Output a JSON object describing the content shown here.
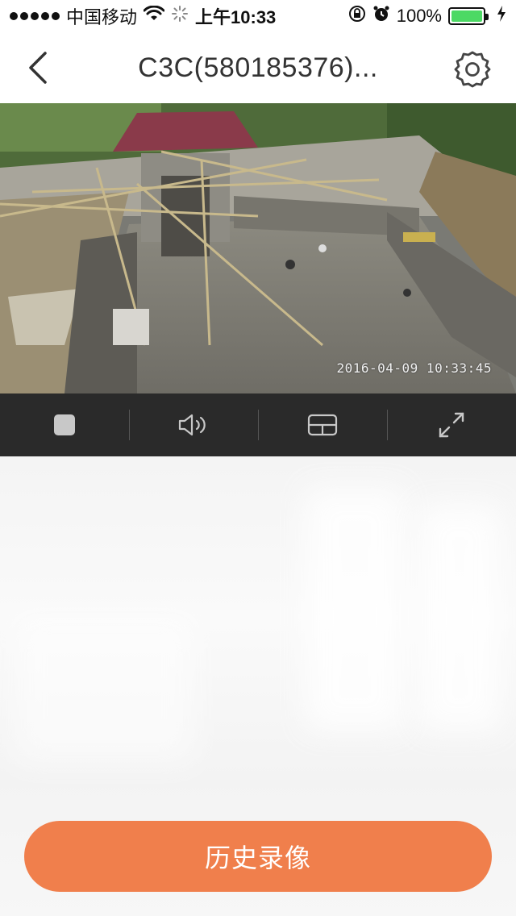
{
  "status_bar": {
    "carrier": "中国移动",
    "time": "上午10:33",
    "battery": "100%",
    "battery_level": 1.0,
    "icons": [
      "signal-dots-icon",
      "wifi-icon",
      "loading-icon",
      "rotation-lock-icon",
      "alarm-icon",
      "battery-icon",
      "charging-icon"
    ]
  },
  "nav": {
    "title": "C3C(580185376)...",
    "back_icon": "chevron-left-icon",
    "settings_icon": "gear-icon"
  },
  "video": {
    "timestamp": "2016-04-09  10:33:45"
  },
  "controls": {
    "items": [
      {
        "name": "stop",
        "icon": "stop-icon"
      },
      {
        "name": "sound",
        "icon": "speaker-icon"
      },
      {
        "name": "layout",
        "icon": "grid-icon"
      },
      {
        "name": "fullscreen",
        "icon": "expand-icon"
      }
    ]
  },
  "history_button": {
    "label": "历史录像"
  },
  "colors": {
    "accent": "#f07f4c",
    "control_bar": "#2a2a2a",
    "battery_fill": "#4cd964"
  }
}
